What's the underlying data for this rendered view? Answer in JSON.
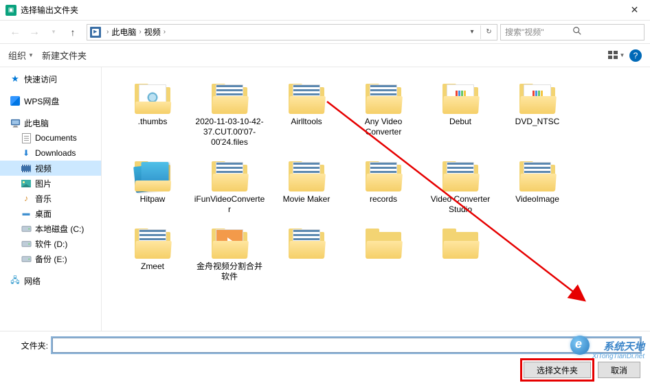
{
  "window": {
    "title": "选择输出文件夹",
    "close": "✕"
  },
  "nav": {
    "back": "←",
    "forward": "→",
    "recent": "▾",
    "up": "↑",
    "crumbs": [
      "此电脑",
      "视频"
    ],
    "dropdown": "▾",
    "refresh": "↻",
    "search_placeholder": "搜索\"视频\""
  },
  "toolbar": {
    "organize": "组织",
    "new_folder": "新建文件夹",
    "view1": "▦",
    "view2": "▾",
    "help": "?"
  },
  "sidebar": [
    {
      "label": "快速访问",
      "icon": "quick"
    },
    {
      "label": "WPS网盘",
      "icon": "wps",
      "space_before": true
    },
    {
      "label": "此电脑",
      "icon": "pc",
      "space_before": true
    },
    {
      "label": "Documents",
      "icon": "doc",
      "child": true
    },
    {
      "label": "Downloads",
      "icon": "dl",
      "child": true
    },
    {
      "label": "视频",
      "icon": "vid",
      "child": true,
      "selected": true
    },
    {
      "label": "图片",
      "icon": "pic",
      "child": true
    },
    {
      "label": "音乐",
      "icon": "mus",
      "child": true
    },
    {
      "label": "桌面",
      "icon": "desk",
      "child": true
    },
    {
      "label": "本地磁盘 (C:)",
      "icon": "disk",
      "child": true
    },
    {
      "label": "软件 (D:)",
      "icon": "disk",
      "child": true
    },
    {
      "label": "备份 (E:)",
      "icon": "disk",
      "child": true
    },
    {
      "label": "网络",
      "icon": "net",
      "space_before": true
    }
  ],
  "items_row1": [
    {
      "label": ".thumbs",
      "kind": "thumbs"
    },
    {
      "label": "2020-11-03-10-42-37.CUT.00'07-00'24.files",
      "kind": "film"
    },
    {
      "label": "Airlltools",
      "kind": "film"
    },
    {
      "label": "Any Video Converter",
      "kind": "film"
    },
    {
      "label": "Debut",
      "kind": "color"
    },
    {
      "label": "DVD_NTSC",
      "kind": "color"
    },
    {
      "label": "Hitpaw",
      "kind": "wallpaper"
    }
  ],
  "items_row2": [
    {
      "label": "iFunVideoConverter",
      "kind": "film"
    },
    {
      "label": "Movie Maker",
      "kind": "film"
    },
    {
      "label": "records",
      "kind": "film"
    },
    {
      "label": "Video Converter Studio",
      "kind": "film"
    },
    {
      "label": "VideoImage",
      "kind": "film"
    },
    {
      "label": "Zmeet",
      "kind": "film"
    },
    {
      "label": "金舟视频分割合并软件",
      "kind": "play"
    }
  ],
  "items_row3": [
    {
      "label": "",
      "kind": "film"
    },
    {
      "label": "",
      "kind": "plain"
    },
    {
      "label": "",
      "kind": "plain"
    }
  ],
  "bottom": {
    "folder_label": "文件夹:",
    "folder_value": "",
    "select_button": "选择文件夹",
    "cancel_button": "取消"
  },
  "watermark": {
    "line1": "系统天地",
    "line2": "XiTongTianDi.net"
  }
}
